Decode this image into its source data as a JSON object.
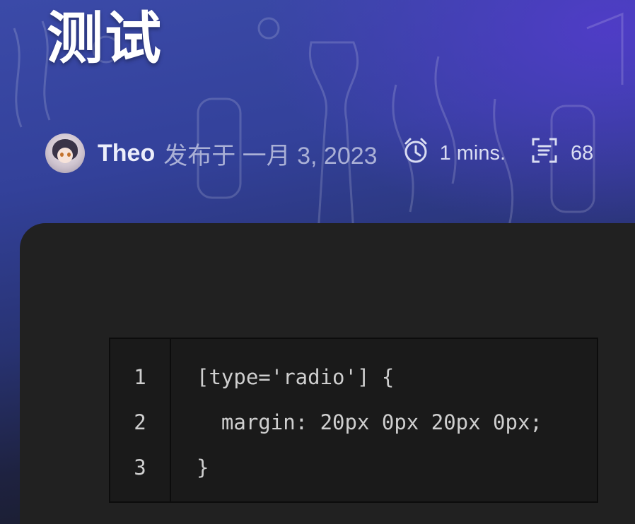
{
  "post": {
    "title": "测试",
    "author": "Theo",
    "published_prefix": "发布于",
    "published_date": "一月 3, 2023",
    "read_time": "1 mins.",
    "word_count": "68"
  },
  "icons": {
    "avatar": "author-avatar",
    "clock": "alarm-clock-icon",
    "words": "text-count-icon"
  },
  "code": {
    "line_numbers": [
      "1",
      "2",
      "3"
    ],
    "lines": [
      "[type='radio'] {",
      "  margin: 20px 0px 20px 0px;",
      "}"
    ]
  },
  "colors": {
    "hero_top": "#3b4aa8",
    "hero_accent": "#5040c8",
    "card_bg": "#212121",
    "code_bg": "#1a1a1a",
    "code_text": "#cfcfcf"
  }
}
